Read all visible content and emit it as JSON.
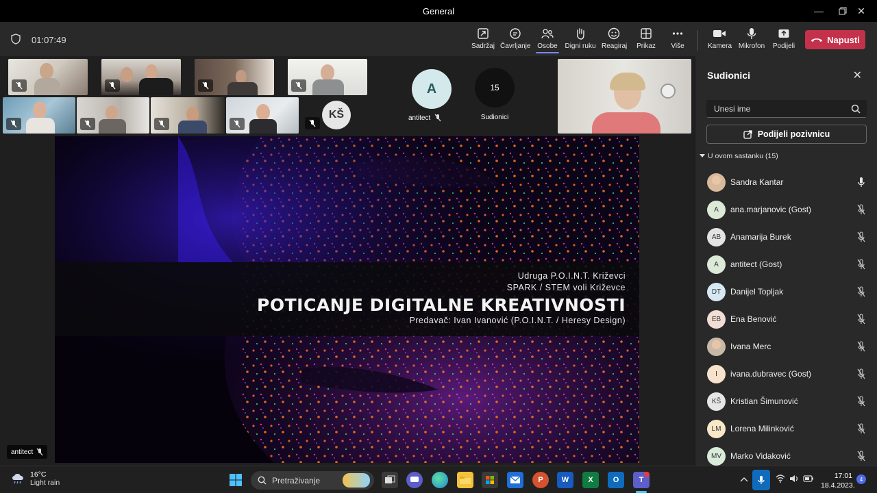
{
  "window": {
    "title": "General"
  },
  "toolbar": {
    "timer": "01:07:49",
    "buttons": [
      {
        "label": "Sadržaj",
        "icon": "share-content-icon"
      },
      {
        "label": "Čavrljanje",
        "icon": "chat-icon"
      },
      {
        "label": "Osobe",
        "icon": "people-icon",
        "active": true
      },
      {
        "label": "Digni ruku",
        "icon": "raise-hand-icon"
      },
      {
        "label": "Reagiraj",
        "icon": "react-icon"
      },
      {
        "label": "Prikaz",
        "icon": "view-icon"
      },
      {
        "label": "Više",
        "icon": "more-icon"
      },
      {
        "label": "Kamera",
        "icon": "camera-icon"
      },
      {
        "label": "Mikrofon",
        "icon": "microphone-icon"
      },
      {
        "label": "Podijeli",
        "icon": "share-icon"
      }
    ],
    "leave_label": "Napusti"
  },
  "stage": {
    "avatar_a": {
      "initial": "A",
      "name": "antitect"
    },
    "participants_count": {
      "value": "15",
      "label": "Sudionici"
    },
    "avatar_ks": {
      "initial": "KŠ"
    },
    "slide": {
      "line1": "Udruga P.O.I.N.T. Križevci",
      "line2": "SPARK / STEM voli Križevce",
      "title": "POTICANJE DIGITALNE KREATIVNOSTI",
      "presenter": "Predavač: Ivan Ivanović (P.O.I.N.T. / Heresy Design)"
    },
    "presenter_label": "antitect"
  },
  "panel": {
    "title": "Sudionici",
    "search_placeholder": "Unesi ime",
    "invite_label": "Podijeli pozivnicu",
    "section_label": "U ovom sastanku (15)",
    "participants": [
      {
        "initials": "",
        "name": "Sandra Kantar",
        "mic": "on",
        "color": "#d9b99b",
        "photo": true
      },
      {
        "initials": "A",
        "name": "ana.marjanovic (Gost)",
        "mic": "muted",
        "color": "#dbe9d6"
      },
      {
        "initials": "AB",
        "name": "Anamarija Burek",
        "mic": "muted",
        "color": "#e3e3e3"
      },
      {
        "initials": "A",
        "name": "antitect (Gost)",
        "mic": "muted",
        "color": "#dbe9d6"
      },
      {
        "initials": "DT",
        "name": "Danijel Topljak",
        "mic": "muted",
        "color": "#d6e9f2"
      },
      {
        "initials": "EB",
        "name": "Ena Benović",
        "mic": "muted",
        "color": "#f1ddd6"
      },
      {
        "initials": "",
        "name": "Ivana Merc",
        "mic": "muted",
        "color": "#c8b8a8",
        "photo": true
      },
      {
        "initials": "I",
        "name": "ivana.dubravec (Gost)",
        "mic": "muted",
        "color": "#f7e2cc"
      },
      {
        "initials": "KŠ",
        "name": "Kristian Šimunović",
        "mic": "muted",
        "color": "#e6e6e6"
      },
      {
        "initials": "LM",
        "name": "Lorena Milinković",
        "mic": "muted",
        "color": "#f7e8c8"
      },
      {
        "initials": "MV",
        "name": "Marko Vidaković",
        "mic": "muted",
        "color": "#d9ecd9"
      }
    ]
  },
  "taskbar": {
    "temperature": "16°C",
    "weather": "Light rain",
    "search_label": "Pretraživanje",
    "time": "17:01",
    "date": "18.4.2023.",
    "notifications": "4"
  }
}
